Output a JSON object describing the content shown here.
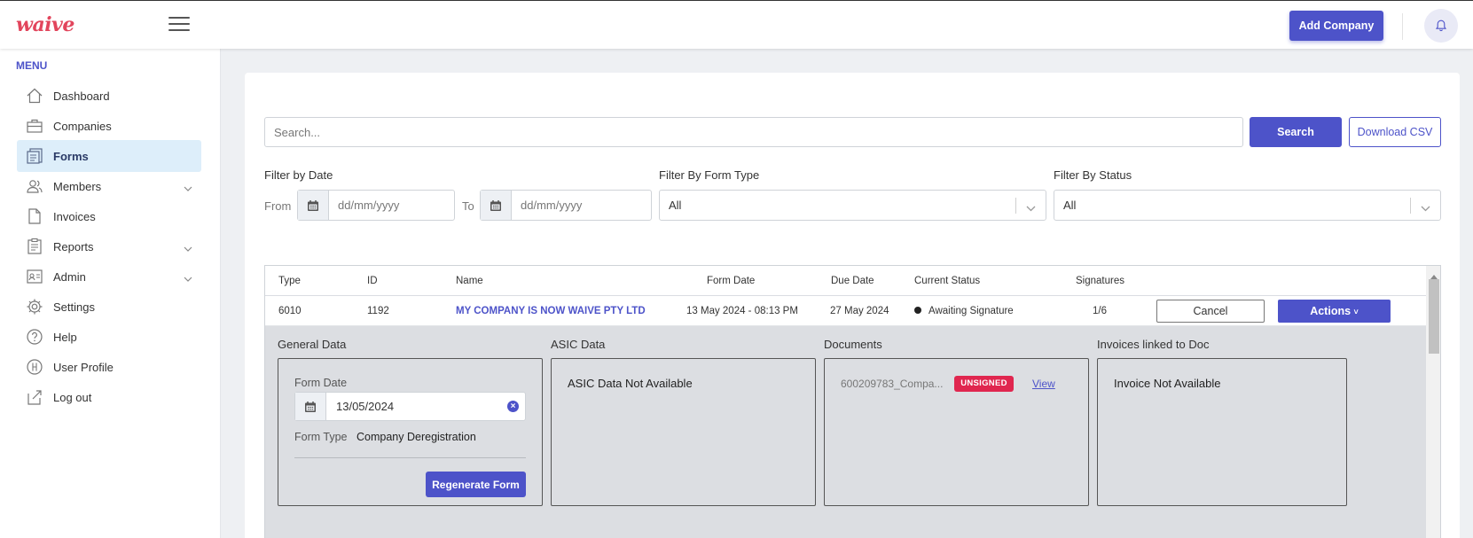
{
  "header": {
    "logo_text": "waive",
    "add_company_label": "Add Company"
  },
  "sidebar": {
    "menu_title": "MENU",
    "items": [
      {
        "label": "Dashboard",
        "icon": "home-icon"
      },
      {
        "label": "Companies",
        "icon": "briefcase-icon"
      },
      {
        "label": "Forms",
        "icon": "forms-icon",
        "active": true
      },
      {
        "label": "Members",
        "icon": "members-icon",
        "has_submenu": true
      },
      {
        "label": "Invoices",
        "icon": "document-icon"
      },
      {
        "label": "Reports",
        "icon": "report-icon",
        "has_submenu": true
      },
      {
        "label": "Admin",
        "icon": "admin-icon",
        "has_submenu": true
      },
      {
        "label": "Settings",
        "icon": "gear-icon"
      },
      {
        "label": "Help",
        "icon": "help-icon"
      },
      {
        "label": "User Profile",
        "icon": "user-profile-icon"
      },
      {
        "label": "Log out",
        "icon": "logout-icon"
      }
    ]
  },
  "search": {
    "placeholder": "Search...",
    "search_label": "Search",
    "download_label": "Download CSV"
  },
  "filters": {
    "date_label": "Filter by Date",
    "from_label": "From",
    "to_label": "To",
    "from_placeholder": "dd/mm/yyyy",
    "to_placeholder": "dd/mm/yyyy",
    "form_type_label": "Filter By Form Type",
    "form_type_value": "All",
    "status_label": "Filter By Status",
    "status_value": "All"
  },
  "table": {
    "columns": [
      "Type",
      "ID",
      "Name",
      "Form Date",
      "Due Date",
      "Current Status",
      "Signatures"
    ],
    "rows": [
      {
        "type": "6010",
        "id": "1192",
        "name": "MY COMPANY IS NOW WAIVE PTY LTD",
        "form_date": "13 May 2024 - 08:13 PM",
        "due_date": "27 May 2024",
        "status": "Awaiting Signature",
        "signatures": "1/6",
        "cancel_label": "Cancel",
        "actions_label": "Actions"
      }
    ]
  },
  "detail": {
    "general": {
      "title": "General Data",
      "form_date_label": "Form Date",
      "form_date_value": "13/05/2024",
      "form_type_label": "Form Type",
      "form_type_value": "Company Deregistration",
      "regenerate_label": "Regenerate Form"
    },
    "asic": {
      "title": "ASIC Data",
      "text": "ASIC Data Not Available"
    },
    "documents": {
      "title": "Documents",
      "doc_name": "600209783_Compa...",
      "badge": "UNSIGNED",
      "view_label": "View"
    },
    "invoices": {
      "title": "Invoices linked to Doc",
      "text": "Invoice Not Available"
    }
  },
  "colors": {
    "primary": "#4d53c9",
    "logo": "#e2455c",
    "unsigned_badge": "#e0264f",
    "active_nav_bg": "#ddeefa"
  }
}
